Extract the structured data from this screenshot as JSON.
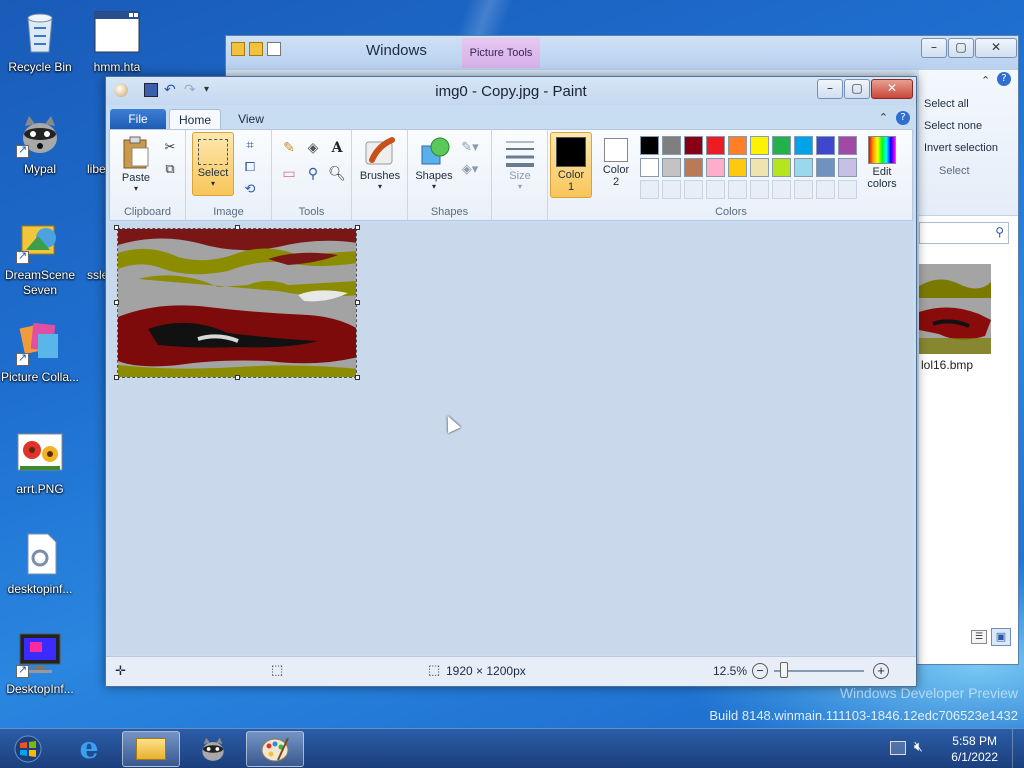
{
  "desktop": {
    "icons": [
      {
        "label": "Recycle Bin"
      },
      {
        "label": "hmm.hta"
      },
      {
        "label": "Mypal"
      },
      {
        "label": "libe"
      },
      {
        "label": "DreamScene Seven"
      },
      {
        "label": "ssle"
      },
      {
        "label": "Picture Colla..."
      },
      {
        "label": "arrt.PNG"
      },
      {
        "label": "desktopinf..."
      },
      {
        "label": "DesktopInf..."
      }
    ],
    "watermark_line1": "Windows Developer Preview",
    "watermark_line2": "Build 8148.winmain.111103-1846.12edc706523e1432"
  },
  "explorer": {
    "title": "Windows",
    "context_tab": "Picture Tools",
    "select_all": "Select all",
    "select_none": "Select none",
    "invert_selection": "Invert selection",
    "group_label": "Select",
    "thumb_label": "lol16.bmp"
  },
  "paint": {
    "title": "img0 - Copy.jpg - Paint",
    "tabs": {
      "file": "File",
      "home": "Home",
      "view": "View"
    },
    "groups": {
      "clipboard": "Clipboard",
      "image": "Image",
      "tools": "Tools",
      "shapes": "Shapes",
      "colors": "Colors"
    },
    "buttons": {
      "paste": "Paste",
      "select": "Select",
      "brushes": "Brushes",
      "shapes": "Shapes",
      "size": "Size",
      "color1": "Color",
      "color1_num": "1",
      "color2": "Color",
      "color2_num": "2",
      "edit_colors": "Edit",
      "edit_colors2": "colors"
    },
    "palette_row1": [
      "#000000",
      "#7f7f7f",
      "#880015",
      "#ed1c24",
      "#ff7f27",
      "#fff200",
      "#22b14c",
      "#00a2e8",
      "#3f48cc",
      "#a349a4"
    ],
    "palette_row2": [
      "#ffffff",
      "#c3c3c3",
      "#b97a57",
      "#ffaec9",
      "#ffc90e",
      "#efe4b0",
      "#b5e61d",
      "#99d9ea",
      "#7092be",
      "#c8bfe7"
    ],
    "status": {
      "dimensions": "1920 × 1200px",
      "zoom": "12.5%"
    }
  },
  "taskbar": {
    "time": "5:58 PM",
    "date": "6/1/2022"
  }
}
